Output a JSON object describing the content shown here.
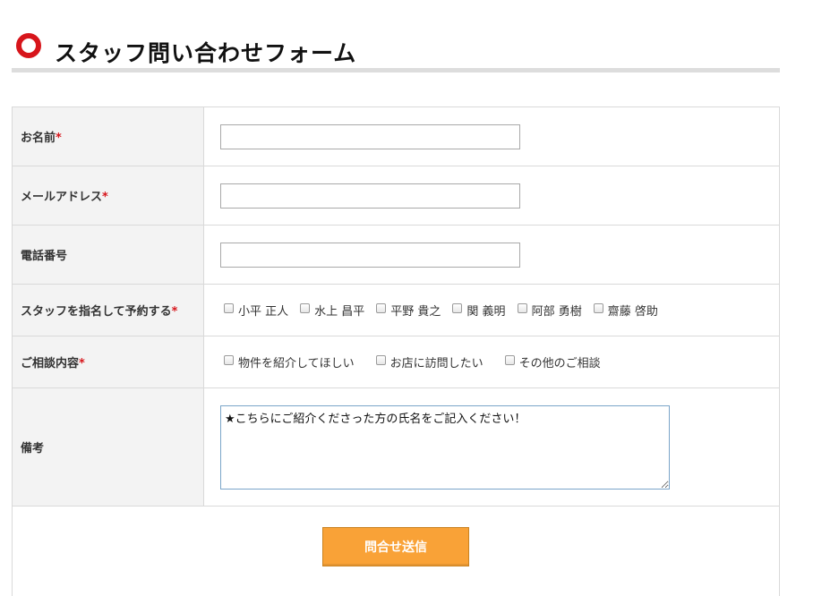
{
  "heading": {
    "title": "スタッフ問い合わせフォーム"
  },
  "colors": {
    "accent": "#d7151b",
    "button": "#f9a237",
    "label_bg": "#f3f3f3"
  },
  "form": {
    "name": {
      "label": "お名前",
      "required_mark": "*",
      "value": ""
    },
    "email": {
      "label": "メールアドレス",
      "required_mark": "*",
      "value": ""
    },
    "phone": {
      "label": "電話番号",
      "value": ""
    },
    "staff": {
      "label": "スタッフを指名して予約する",
      "required_mark": "*",
      "options": [
        "小平 正人",
        "水上 昌平",
        "平野 貴之",
        "関 義明",
        "阿部 勇樹",
        "齋藤 啓助"
      ]
    },
    "consult": {
      "label": "ご相談内容",
      "required_mark": "*",
      "options": [
        "物件を紹介してほしい",
        "お店に訪問したい",
        "その他のご相談"
      ]
    },
    "remarks": {
      "label": "備考",
      "value": "★こちらにご紹介くださった方の氏名をご記入ください！"
    },
    "submit_label": "問合せ送信"
  }
}
